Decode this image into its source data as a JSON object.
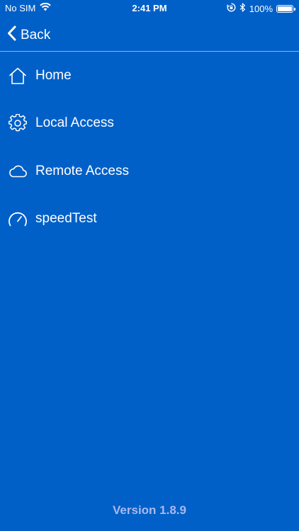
{
  "status_bar": {
    "carrier": "No SIM",
    "time": "2:41 PM",
    "battery": "100%",
    "icons": [
      "wifi-icon",
      "rotation-lock-icon",
      "bluetooth-icon",
      "battery-icon"
    ]
  },
  "nav": {
    "back_label": "Back",
    "back_icon": "chevron-left-icon"
  },
  "menu": {
    "items": [
      {
        "label": "Home",
        "icon": "home-icon"
      },
      {
        "label": "Local Access",
        "icon": "gear-icon"
      },
      {
        "label": "Remote Access",
        "icon": "cloud-icon"
      },
      {
        "label": "speedTest",
        "icon": "speedometer-icon"
      }
    ]
  },
  "footer": {
    "version": "Version 1.8.9"
  },
  "colors": {
    "background": "#0060c8",
    "text": "#ffffff",
    "version_text": "#a9b9f0"
  }
}
